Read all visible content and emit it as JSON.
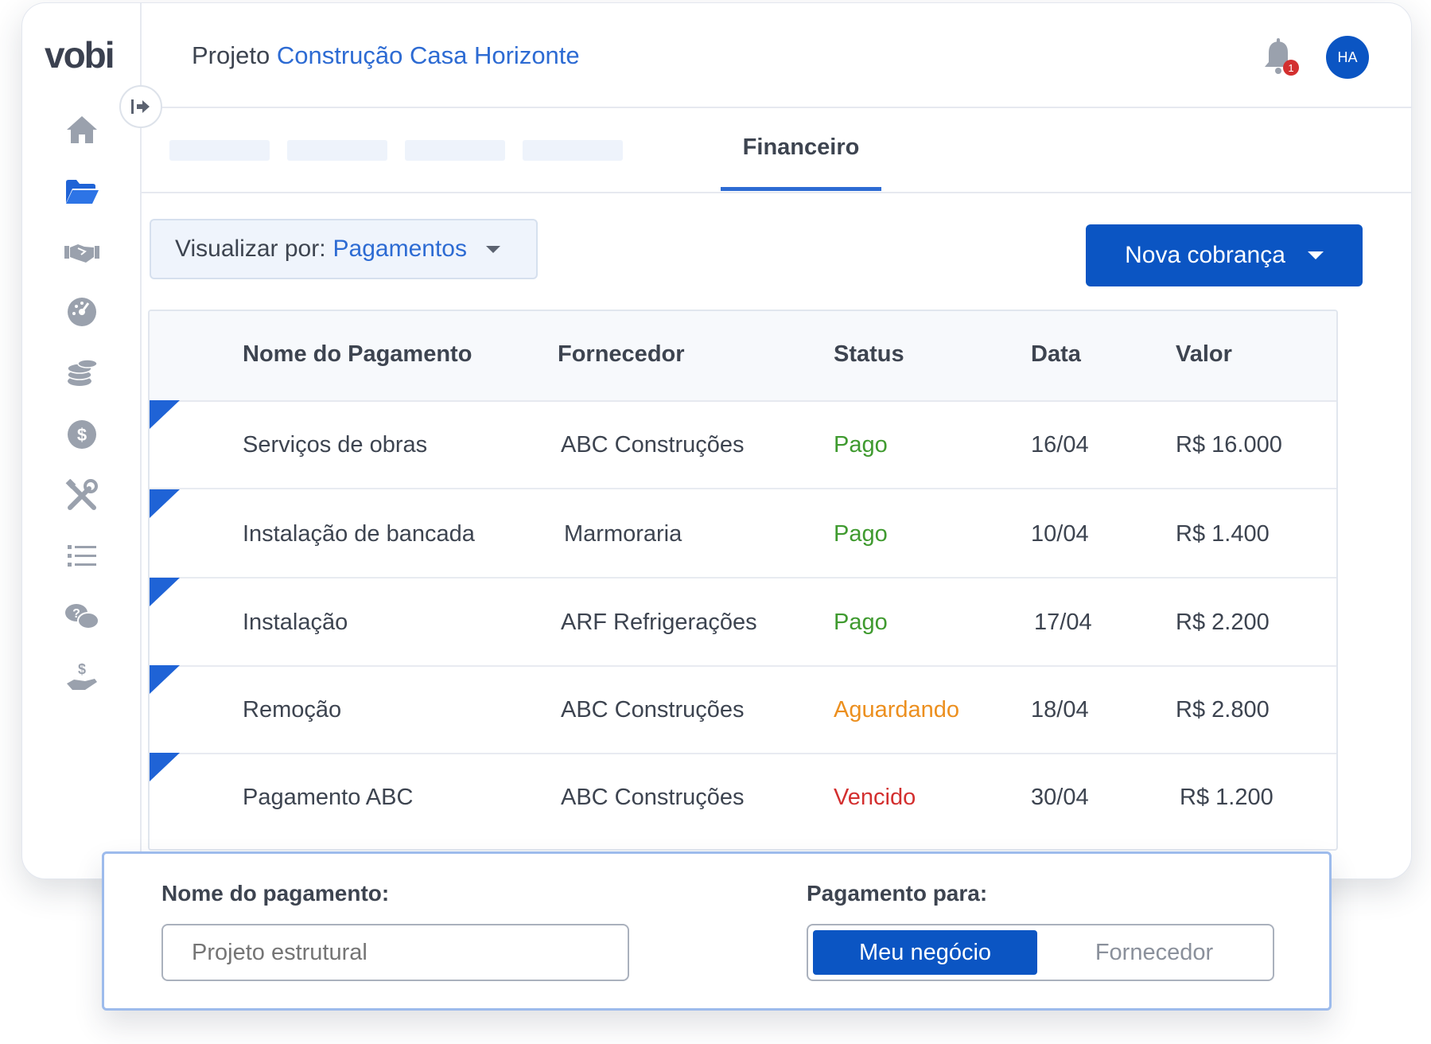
{
  "app": {
    "logo": "vobi"
  },
  "header": {
    "project_prefix": "Projeto",
    "project_name": "Construção Casa Horizonte",
    "notification_count": "1",
    "avatar_initials": "HA"
  },
  "sidebar": {
    "items": [
      {
        "icon": "home-icon"
      },
      {
        "icon": "folder-icon"
      },
      {
        "icon": "handshake-icon"
      },
      {
        "icon": "gauge-icon"
      },
      {
        "icon": "coins-icon"
      },
      {
        "icon": "dollar-circle-icon"
      },
      {
        "icon": "tools-icon"
      },
      {
        "icon": "list-icon"
      },
      {
        "icon": "chat-help-icon"
      },
      {
        "icon": "hand-dollar-icon"
      }
    ]
  },
  "tabs": {
    "active_label": "Financeiro"
  },
  "toolbar": {
    "view_label": "Visualizar por:",
    "view_value": "Pagamentos",
    "new_charge_label": "Nova cobrança"
  },
  "table": {
    "headers": {
      "name": "Nome do Pagamento",
      "supplier": "Fornecedor",
      "status": "Status",
      "date": "Data",
      "value": "Valor"
    },
    "rows": [
      {
        "name": "Serviços de obras",
        "supplier": "ABC Construções",
        "status": "Pago",
        "status_kind": "pago",
        "date": "16/04",
        "value": "R$ 16.000"
      },
      {
        "name": "Instalação de bancada",
        "supplier": "Marmoraria",
        "status": "Pago",
        "status_kind": "pago",
        "date": "10/04",
        "value": "R$ 1.400"
      },
      {
        "name": "Instalação",
        "supplier": "ARF Refrigerações",
        "status": "Pago",
        "status_kind": "pago",
        "date": "17/04",
        "value": "R$ 2.200"
      },
      {
        "name": "Remoção",
        "supplier": "ABC Construções",
        "status": "Aguardando",
        "status_kind": "aguardando",
        "date": "18/04",
        "value": "R$ 2.800"
      },
      {
        "name": "Pagamento ABC",
        "supplier": "ABC Construções",
        "status": "Vencido",
        "status_kind": "vencido",
        "date": "30/04",
        "value": "R$ 1.200"
      }
    ]
  },
  "form": {
    "name_label": "Nome do pagamento:",
    "name_placeholder": "Projeto estrutural",
    "pay_to_label": "Pagamento para:",
    "pay_to_options": [
      "Meu negócio",
      "Fornecedor"
    ],
    "pay_to_selected": "Meu negócio"
  },
  "colors": {
    "brand_blue": "#0b55c3",
    "link_blue": "#2d6bd3",
    "status_pago": "#3f9a2f",
    "status_aguardando": "#ec8f1e",
    "status_vencido": "#d32f2f"
  }
}
